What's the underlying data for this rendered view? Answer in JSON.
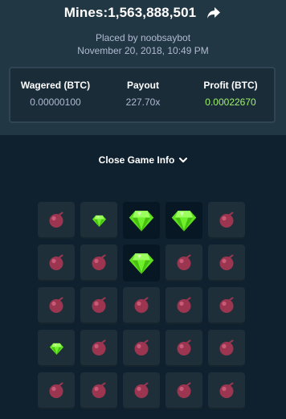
{
  "game": {
    "title": "Mines:1,563,888,501",
    "placed_by": "Placed by noobsaybot",
    "timestamp": "November 20, 2018, 10:49 PM",
    "share_icon": "share-arrow-icon"
  },
  "stats": {
    "wagered_label": "Wagered (BTC)",
    "wagered_value": "0.00000100",
    "payout_label": "Payout",
    "payout_value": "227.70x",
    "profit_label": "Profit (BTC)",
    "profit_value": "0.00022670"
  },
  "toggle": {
    "label": "Close Game Info",
    "icon": "chevron-down-icon"
  },
  "colors": {
    "background": "#0f212e",
    "header": "#213743",
    "profit": "#9ff46b",
    "gem": "#5fe01f",
    "mine": "#9c3650"
  },
  "board": {
    "cells": [
      "mine",
      "gem-small",
      "gem-large",
      "gem-large",
      "mine",
      "mine",
      "mine",
      "gem-large",
      "mine",
      "mine",
      "mine",
      "mine",
      "mine",
      "mine",
      "mine",
      "gem-small",
      "mine",
      "mine",
      "mine",
      "mine",
      "mine",
      "mine",
      "mine",
      "mine",
      "mine"
    ]
  }
}
